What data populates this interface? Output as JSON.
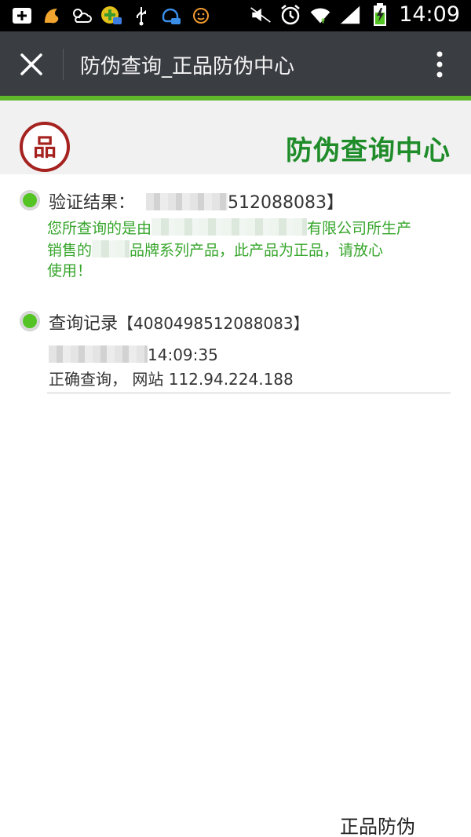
{
  "status_bar": {
    "time": "14:09",
    "icons": [
      "add-box-icon",
      "uc-browser-icon",
      "weather-icon",
      "app-notification-icon",
      "usb-icon",
      "chat-icon",
      "face-icon",
      "mute-icon",
      "alarm-icon",
      "wifi-icon",
      "signal-icon",
      "battery-charging-icon"
    ]
  },
  "appbar": {
    "title": "防伪查询_正品防伪中心"
  },
  "header": {
    "center_title": "防伪查询中心",
    "logo_char": "品"
  },
  "result": {
    "label": "验证结果：",
    "code_tail": "512088083】",
    "message_line1_prefix": "您所查询的是由",
    "message_line1_suffix": "有限公司所生产",
    "message_line2_prefix": "销售的",
    "message_line2_suffix": "品牌系列产品，此产品为正品，请放心",
    "message_line3": "使用！"
  },
  "record": {
    "label": "查询记录",
    "code": "【4080498512088083】",
    "time_tail": "14:09:35",
    "detail": "正确查询， 网站 112.94.224.188"
  },
  "footer": {
    "text": "正品防伪"
  },
  "colors": {
    "appbar": "#3a3d42",
    "accent_green": "#5fb829",
    "title_green": "#1f8c2a",
    "message_green": "#36a52b",
    "dot_green": "#53c423"
  }
}
